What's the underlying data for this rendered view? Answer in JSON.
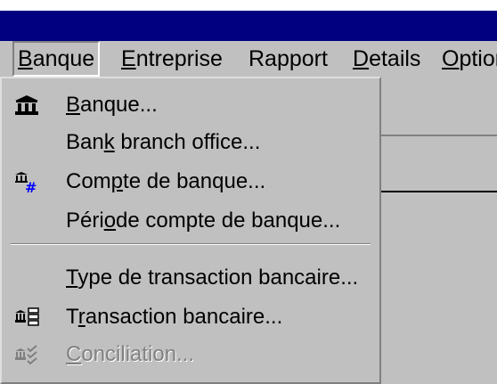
{
  "menubar": {
    "items": [
      {
        "label_pre": "",
        "label_u": "B",
        "label_post": "anque"
      },
      {
        "label_pre": "",
        "label_u": "E",
        "label_post": "ntreprise"
      },
      {
        "label_pre": "Rapport",
        "label_u": "",
        "label_post": ""
      },
      {
        "label_pre": "",
        "label_u": "D",
        "label_post": "etails"
      },
      {
        "label_pre": "",
        "label_u": "O",
        "label_post": "ptior"
      }
    ]
  },
  "dropdown": {
    "items": [
      {
        "icon": "bank-icon",
        "label_pre": "",
        "label_u": "B",
        "label_post": "anque..."
      },
      {
        "icon": "",
        "label_pre": "Ban",
        "label_u": "k",
        "label_post": " branch office..."
      },
      {
        "icon": "bank-account-icon",
        "label_pre": "Com",
        "label_u": "p",
        "label_post": "te de banque..."
      },
      {
        "icon": "",
        "label_pre": "Péri",
        "label_u": "o",
        "label_post": "de compte de banque..."
      },
      {
        "icon": "",
        "label_pre": "",
        "label_u": "T",
        "label_post": "ype de transaction bancaire..."
      },
      {
        "icon": "bank-transaction-icon",
        "label_pre": "T",
        "label_u": "r",
        "label_post": "ansaction bancaire..."
      },
      {
        "icon": "reconciliation-icon",
        "label_pre": "",
        "label_u": "C",
        "label_post": "onciliation...",
        "disabled": true
      }
    ]
  }
}
